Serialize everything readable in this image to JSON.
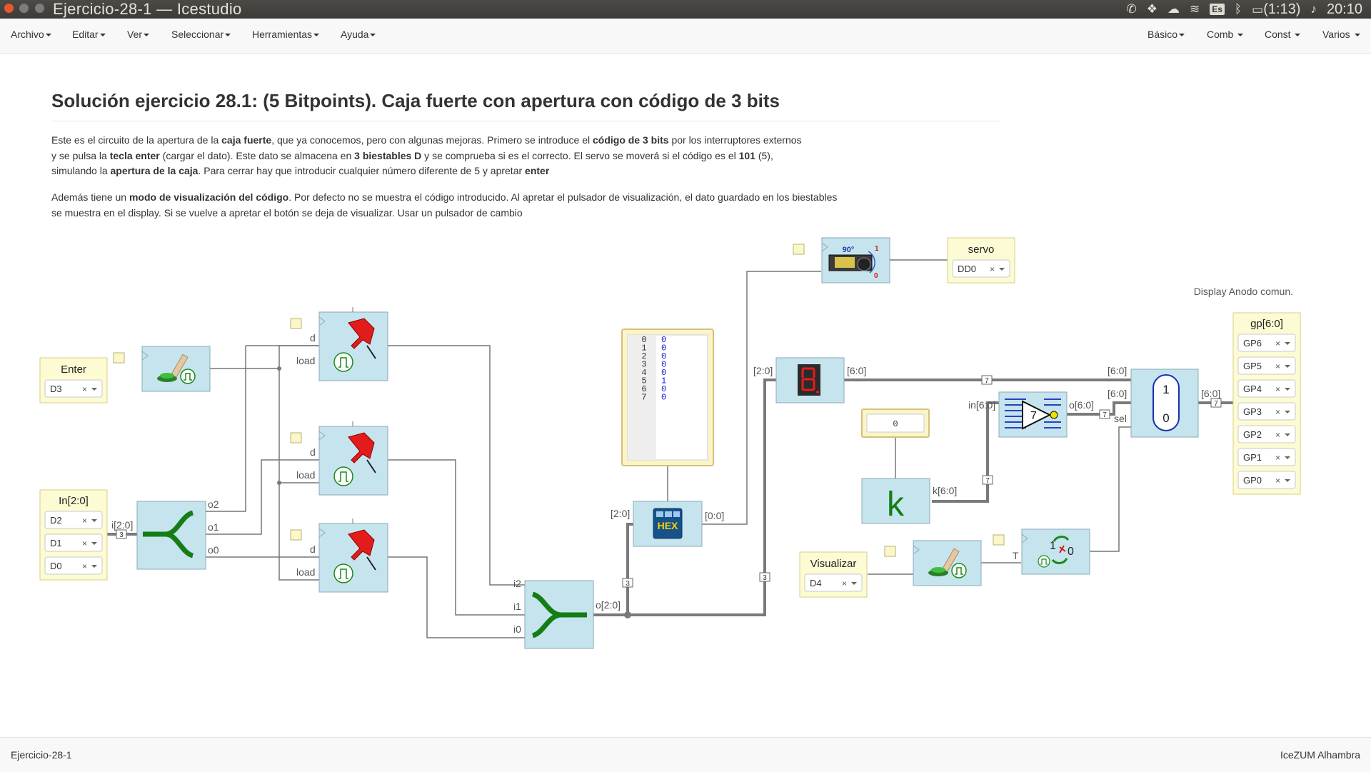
{
  "window": {
    "title": "Ejercicio-28-1 — Icestudio"
  },
  "tray": {
    "lang": "Es",
    "battery": "(1:13)",
    "clock": "20:10"
  },
  "menu_left": [
    "Archivo",
    "Editar",
    "Ver",
    "Seleccionar",
    "Herramientas",
    "Ayuda"
  ],
  "menu_right": [
    "Básico",
    "Comb",
    "Const",
    "Varios"
  ],
  "heading": "Solución ejercicio 28.1: (5 Bitpoints). Caja fuerte con apertura con código de 3 bits",
  "para1": {
    "l1a": "Este es el circuito de la apertura de la ",
    "l1b": "caja fuerte",
    "l1c": ", que ya conocemos, pero con algunas mejoras. Primero se introduce el ",
    "l1d": "código de 3 bits",
    "l1e": " por los interruptores externos",
    "l2a": "y se pulsa la ",
    "l2b": "tecla enter",
    "l2c": " (cargar el dato). Este dato se almacena en ",
    "l2d": "3 biestables D",
    "l2e": " y se comprueba si es el correcto. El servo se moverá si el código es el ",
    "l2f": "101",
    "l2g": " (5),",
    "l3a": "simulando la ",
    "l3b": "apertura de la caja",
    "l3c": ". Para cerrar hay que introducir cualquier número diferente de 5 y apretar ",
    "l3d": "enter"
  },
  "para2": {
    "l1a": "Además tiene un ",
    "l1b": "modo de visualización del código",
    "l1c": ". Por defecto no se muestra el código introducido. Al apretar el pulsador de visualización, el dato guardado en los biestables",
    "l2": "se muestra en el display. Si se vuelve a apretar el botón se deja de visualizar. Usar un pulsador de cambio"
  },
  "circuit": {
    "enter": {
      "title": "Enter",
      "pin": "D3"
    },
    "in": {
      "title": "In[2:0]",
      "pins": [
        "D2",
        "D1",
        "D0"
      ]
    },
    "visualizar": {
      "title": "Visualizar",
      "pin": "D4"
    },
    "servo": {
      "title": "servo",
      "pin": "DD0"
    },
    "gp": {
      "title": "gp[6:0]",
      "pins": [
        "GP6",
        "GP5",
        "GP4",
        "GP3",
        "GP2",
        "GP1",
        "GP0"
      ]
    },
    "display_note": "Display Anodo comun.",
    "split_ports": {
      "in": "i[2:0]",
      "o2": "o2",
      "o1": "o1",
      "o0": "o0"
    },
    "dff_ports": {
      "d": "d",
      "load": "load"
    },
    "join_ports": {
      "i2": "i2",
      "i1": "i1",
      "i0": "i0",
      "out": "o[2:0]"
    },
    "hex_ports": {
      "in": "[2:0]",
      "out": "[0:0]"
    },
    "seg_ports": {
      "in": "[2:0]",
      "out": "[6:0]"
    },
    "not_ports": {
      "in": "in[6:0]",
      "out": "o[6:0]"
    },
    "mux_ports": {
      "a": "[6:0]",
      "b": "[6:0]",
      "out": "[6:0]",
      "sel": "sel"
    },
    "const_ports": {
      "out": "k[6:0]"
    },
    "tff_ports": {
      "t": "T"
    },
    "mux_labels": {
      "top": "1",
      "bottom": "0"
    },
    "tff_labels": {
      "a": "1",
      "b": "0"
    },
    "const_value": "0",
    "const_letter": "k",
    "not_number": "7",
    "servo_labels": {
      "angle": "90°",
      "one": "1",
      "zero": "0"
    },
    "hex_text": "HEX",
    "bus_widths": {
      "split": "3",
      "hex": "3",
      "seg": "3",
      "seven_a": "7",
      "seven_b": "7",
      "seven_c": "7",
      "seven_d": "7"
    },
    "table": {
      "addresses": [
        "0",
        "1",
        "2",
        "3",
        "4",
        "5",
        "6",
        "7"
      ],
      "values": [
        "0",
        "0",
        "0",
        "0",
        "0",
        "1",
        "0",
        "0"
      ]
    }
  },
  "footer": {
    "left": "Ejercicio-28-1",
    "right": "IceZUM Alhambra"
  }
}
